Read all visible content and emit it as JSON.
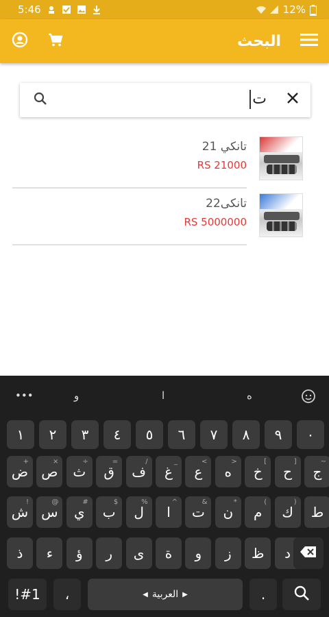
{
  "status_bar": {
    "time": "5:46",
    "battery": "12%"
  },
  "app_bar": {
    "title": "البحث"
  },
  "search": {
    "query": "ت"
  },
  "results": [
    {
      "name": "تانكي 21",
      "price": "RS 21000"
    },
    {
      "name": "تانكى22",
      "price": "RS 5000000"
    }
  ],
  "keyboard": {
    "suggestions": [
      "و",
      "ا",
      "ه"
    ],
    "digits": [
      "١",
      "٢",
      "٣",
      "٤",
      "٥",
      "٦",
      "٧",
      "٨",
      "٩",
      "٠"
    ],
    "row1": [
      "ض",
      "ص",
      "ث",
      "ق",
      "ف",
      "غ",
      "ع",
      "ه",
      "خ",
      "ح",
      "ج"
    ],
    "row1_hints": [
      "+",
      "×",
      "÷",
      "=",
      "/",
      "_",
      "<",
      ">",
      "[",
      "]",
      "~"
    ],
    "row2": [
      "ش",
      "س",
      "ي",
      "ب",
      "ل",
      "ا",
      "ت",
      "ن",
      "م",
      "ك",
      "ط"
    ],
    "row2_hints": [
      "!",
      "@",
      "#",
      "$",
      "%",
      "^",
      "&",
      "*",
      "(",
      ")",
      ""
    ],
    "row3": [
      "ذ",
      "ء",
      "ؤ",
      "ر",
      "ى",
      "ة",
      "و",
      "ز",
      "ظ",
      "د"
    ],
    "symbols_label": "!#1",
    "comma": "،",
    "space_label": "العربية",
    "period": "."
  },
  "colors": {
    "accent": "#f3b81f",
    "status": "#e6ad1a",
    "price": "#e53935",
    "keyboard_bg": "#1f1f1f",
    "key_bg": "#3b3b3b"
  }
}
